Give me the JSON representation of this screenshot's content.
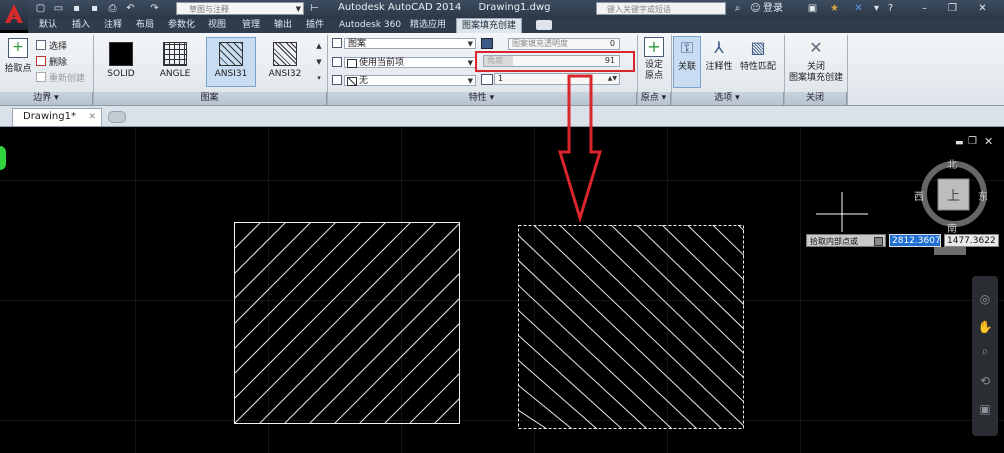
{
  "title_bar": {
    "workspace": "草图与注释",
    "app_title": "Autodesk AutoCAD 2014",
    "file_name": "Drawing1.dwg",
    "search_placeholder": "键入关键字或短语",
    "login": "登录"
  },
  "tabs": [
    "默认",
    "插入",
    "注释",
    "布局",
    "参数化",
    "视图",
    "管理",
    "输出",
    "插件",
    "Autodesk 360",
    "精选应用",
    "图案填充创建"
  ],
  "active_tab": "图案填充创建",
  "ribbon": {
    "boundary": {
      "pick_point": "拾取点",
      "select": "选择",
      "remove": "删除",
      "recreate": "重新创建",
      "panel_label": "边界"
    },
    "pattern": {
      "swatches": [
        "SOLID",
        "ANGLE",
        "ANSI31",
        "ANSI32"
      ],
      "selected": "ANSI31",
      "panel_label": "图案"
    },
    "properties": {
      "type": "图案",
      "color": "使用当前项",
      "background": "无",
      "transparency_label": "图案填充透明度",
      "transparency_value": "0",
      "angle_label": "角度",
      "angle_value": "91",
      "scale_value": "1",
      "panel_label": "特性"
    },
    "origin": {
      "set_origin": "设定\n原点",
      "panel_label": "原点"
    },
    "options": {
      "associative": "关联",
      "annotative": "注释性",
      "match_properties": "特性匹配",
      "panel_label": "选项"
    },
    "close": {
      "close_label": "关闭\n图案填充创建",
      "panel_label": "关闭"
    }
  },
  "document_tab": "Drawing1*",
  "canvas": {
    "tooltip": "拾取内部点或",
    "coord_x": "2812.3607",
    "coord_y": "1477.3622",
    "viewcube": {
      "north": "北",
      "south": "南",
      "east": "东",
      "west": "西",
      "face": "上"
    }
  },
  "colors": {
    "highlight_red": "#d9252b",
    "canvas_bg": "#000000",
    "selected_blue": "#1f6fd0"
  }
}
